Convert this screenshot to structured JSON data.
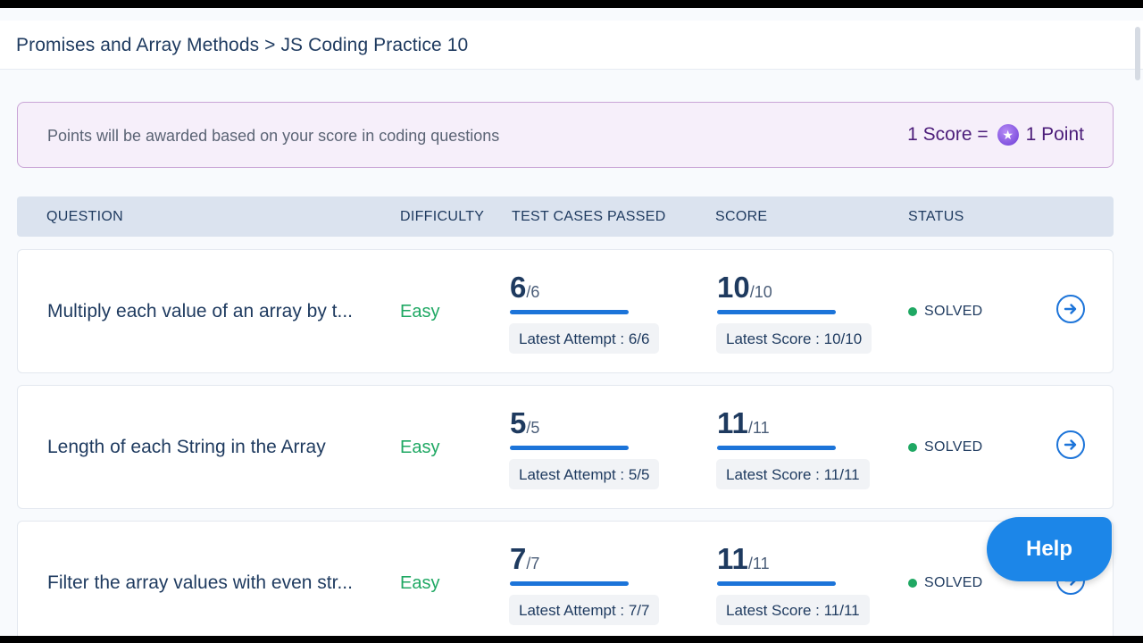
{
  "breadcrumb": "Promises and Array Methods > JS Coding Practice 10",
  "notice": {
    "text": "Points will be awarded based on your score in coding questions",
    "score_label": "1 Score =",
    "point_label": "1 Point",
    "coin_icon": "star-coin-icon"
  },
  "table": {
    "headers": {
      "question": "QUESTION",
      "difficulty": "DIFFICULTY",
      "test_cases": "TEST CASES PASSED",
      "score": "SCORE",
      "status": "STATUS"
    },
    "rows": [
      {
        "question": "Multiply each value of an array by t...",
        "difficulty": "Easy",
        "tests_passed": "6",
        "tests_total": "/6",
        "latest_attempt": "Latest Attempt : 6/6",
        "score": "10",
        "score_total": "/10",
        "latest_score": "Latest Score : 10/10",
        "status": "SOLVED"
      },
      {
        "question": "Length of each String in the Array",
        "difficulty": "Easy",
        "tests_passed": "5",
        "tests_total": "/5",
        "latest_attempt": "Latest Attempt : 5/5",
        "score": "11",
        "score_total": "/11",
        "latest_score": "Latest Score : 11/11",
        "status": "SOLVED"
      },
      {
        "question": "Filter the array values with even str...",
        "difficulty": "Easy",
        "tests_passed": "7",
        "tests_total": "/7",
        "latest_attempt": "Latest Attempt : 7/7",
        "score": "11",
        "score_total": "/11",
        "latest_score": "Latest Score : 11/11",
        "status": "SOLVED"
      }
    ]
  },
  "help_button": "Help",
  "colors": {
    "accent": "#1c74d9",
    "success": "#1fa863",
    "heading": "#1e3a5f",
    "notice_border": "#c9a4d6",
    "notice_bg": "#f6effa"
  }
}
